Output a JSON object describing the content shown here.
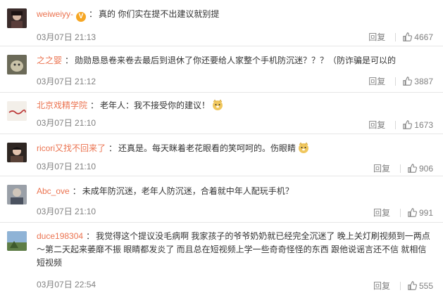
{
  "comments": [
    {
      "username": "weiweiyy-",
      "verified": true,
      "text": "真的 你们实在提不出建议就别提",
      "date": "03月07日 21:13",
      "reply_label": "回复",
      "likes": "4667",
      "avatar_color": "#3a2b2a",
      "emoji": false
    },
    {
      "username": "之之婴",
      "verified": false,
      "text": "勋勋恳恳卷来卷去最后到退休了你还要给人家整个手机防沉迷？？？（防诈骗是可以的",
      "date": "03月07日 21:12",
      "reply_label": "回复",
      "likes": "3887",
      "avatar_color": "#6b6a58",
      "emoji": false
    },
    {
      "username": "北京戏精学院",
      "verified": false,
      "text": "老年人：我不接受你的建议！",
      "date": "03月07日 21:10",
      "reply_label": "回复",
      "likes": "1673",
      "avatar_color": "#f3efe9",
      "emoji": true
    },
    {
      "username": "ricori又找不回来了",
      "verified": false,
      "text": "还真是。每天眯着老花眼看的笑呵呵的。伤眼睛",
      "date": "03月07日 21:10",
      "reply_label": "回复",
      "likes": "906",
      "avatar_color": "#2e2622",
      "emoji": true
    },
    {
      "username": "Abc_ove",
      "verified": false,
      "text": "未成年防沉迷，老年人防沉迷，合着就中年人配玩手机？",
      "date": "03月07日 21:10",
      "reply_label": "回复",
      "likes": "991",
      "avatar_color": "#7a7f8a",
      "emoji": false
    },
    {
      "username": "duce198304",
      "verified": false,
      "text": "我觉得这个提议没毛病啊 我家孩子的爷爷奶奶就已经完全沉迷了 晚上关灯刷视频到一两点～第二天起来萎靡不振 眼睛都发炎了 而且总在短视频上学一些奇奇怪怪的东西 跟他说谣言还不信 就相信短视频",
      "date": "03月07日 22:54",
      "reply_label": "回复",
      "likes": "555",
      "avatar_color": "#6f8a5c",
      "emoji": false
    }
  ]
}
